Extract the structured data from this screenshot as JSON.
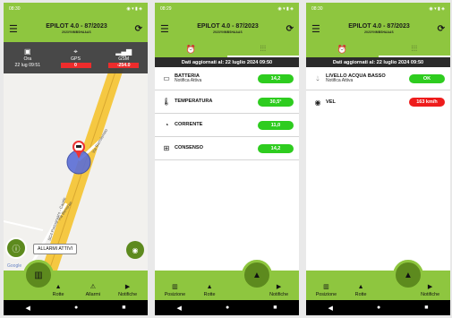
{
  "app": {
    "title": "EPILOT 4.0 -  87/2023",
    "subtitle": "2023YNMBSHAAAS"
  },
  "screens": [
    {
      "status_time": "08:30",
      "info": {
        "ora_label": "Ora",
        "ora_value": "22 lug 09:51",
        "gps_label": "GPS",
        "gps_value": "0",
        "gsm_label": "GSM",
        "gsm_value": "-254.0"
      },
      "map": {
        "road1": "SC4 Portogruaro - Caorle",
        "road2": "Via Benorae",
        "road3": "Via Bartolomeo",
        "alarm_tip": "ALLARMI ATTIVI",
        "google": "Google"
      },
      "nav": [
        "Rotte",
        "Allarmi",
        "Notifiche"
      ]
    },
    {
      "status_time": "08:29",
      "updated": "Dati aggiornati al: 22 luglio 2024 09:50",
      "rows": [
        {
          "icon": "battery-icon",
          "name": "BATTERIA",
          "sub": "Notifica Attiva",
          "value": "14,2",
          "color": "#2ecc1f"
        },
        {
          "icon": "thermometer-icon",
          "name": "TEMPERATURA",
          "sub": "",
          "value": "30,5°",
          "color": "#2ecc1f"
        },
        {
          "icon": "gauge-icon",
          "name": "CORRENTE",
          "sub": "",
          "value": "11,0",
          "color": "#2ecc1f"
        },
        {
          "icon": "ignition-icon",
          "name": "CONSENSO",
          "sub": "",
          "value": "14,2",
          "color": "#2ecc1f"
        }
      ],
      "nav": [
        "Posizione",
        "Rotte",
        "Notifiche"
      ]
    },
    {
      "status_time": "08:30",
      "updated": "Dati aggiornati al: 22 luglio 2024 09:50",
      "rows": [
        {
          "icon": "water-drop-icon",
          "name": "LIVELLO ACQUA BASSO",
          "sub": "Notifica Attiva",
          "value": "OK",
          "color": "#2ecc1f"
        },
        {
          "icon": "speed-icon",
          "name": "VEL",
          "sub": "",
          "value": "163 km/h",
          "color": "#ee1c1c"
        }
      ],
      "nav": [
        "Posizione",
        "Rotte",
        "Notifiche"
      ]
    }
  ]
}
